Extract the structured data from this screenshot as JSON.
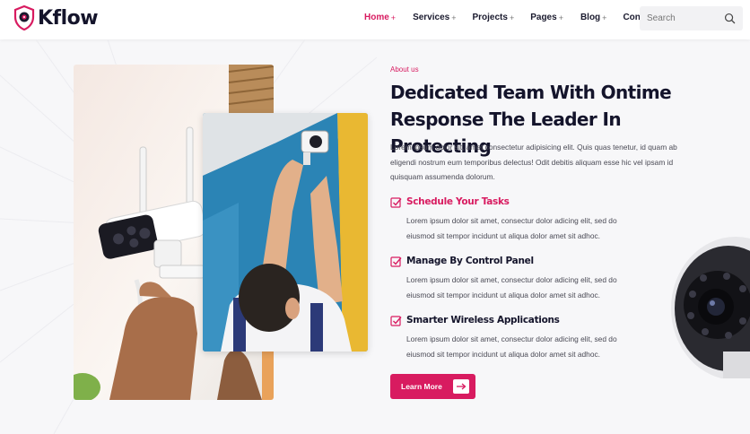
{
  "brand": {
    "name": "Kflow",
    "logo_icon": "shield-camera-logo",
    "accent_color": "#d81b60"
  },
  "nav": {
    "items": [
      {
        "label": "Home",
        "suffix": "+"
      },
      {
        "label": "Services",
        "suffix": "+"
      },
      {
        "label": "Projects",
        "suffix": "+"
      },
      {
        "label": "Pages",
        "suffix": "+"
      },
      {
        "label": "Blog",
        "suffix": "+"
      },
      {
        "label": "Contact",
        "suffix": ""
      }
    ],
    "active_item": "Home"
  },
  "search": {
    "placeholder": "Search",
    "icon": "search-icon"
  },
  "about": {
    "eyebrow": "About us",
    "title_line1": "Dedicated Team With Ontime",
    "title_line2": "Response The Leader In Protecting",
    "intro": "Lorem ipsum dolor sit, amet consectetur adipisicing elit. Quis quas tenetur, id quam ab eligendi nostrum eum temporibus delectus! Odit debitis aliquam esse hic vel ipsam id quisquam assumenda dolorum."
  },
  "features": [
    {
      "title": "Schedule Your Tasks",
      "icon": "checkbox-icon",
      "description": "Lorem ipsum dolor sit amet, consectur dolor adicing elit, sed do eiusmod sit tempor incidunt ut aliqua dolor amet sit adhoc."
    },
    {
      "title": "Manage By Control Panel",
      "icon": "checkbox-icon",
      "description": "Lorem ipsum dolor sit amet, consectur dolor adicing elit, sed do eiusmod sit tempor incidunt ut aliqua dolor amet sit adhoc."
    },
    {
      "title": "Smarter Wireless Applications",
      "icon": "checkbox-icon",
      "description": "Lorem ipsum dolor sit amet, consectur dolor adicing elit, sed do eiusmod sit tempor incidunt ut aliqua dolor amet sit adhoc."
    }
  ],
  "cta": {
    "label": "Learn More",
    "icon": "arrow-right-icon"
  }
}
